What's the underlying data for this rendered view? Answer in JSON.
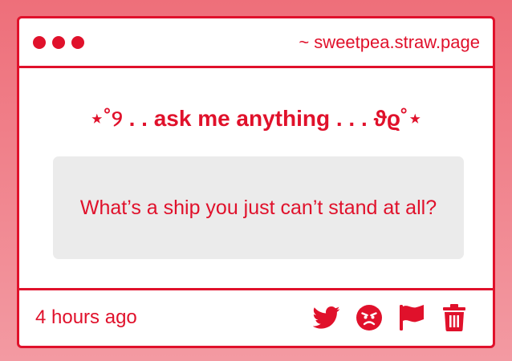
{
  "window": {
    "url": "~ sweetpea.straw.page"
  },
  "main": {
    "heading": "⋆˚୨ . . ask me anything . . . ϑϱ˚⋆",
    "question": "What’s a ship you just can’t stand at all?"
  },
  "footer": {
    "timestamp": "4 hours ago",
    "actions": [
      {
        "icon": "twitter-icon"
      },
      {
        "icon": "angry-face-icon"
      },
      {
        "icon": "flag-icon"
      },
      {
        "icon": "trash-icon"
      }
    ]
  },
  "colors": {
    "accent": "#e0112b",
    "card_bg": "#ffffff",
    "question_bg": "#ebebeb",
    "page_bg_top": "#ee6f7a",
    "page_bg_bottom": "#f39aa2"
  }
}
